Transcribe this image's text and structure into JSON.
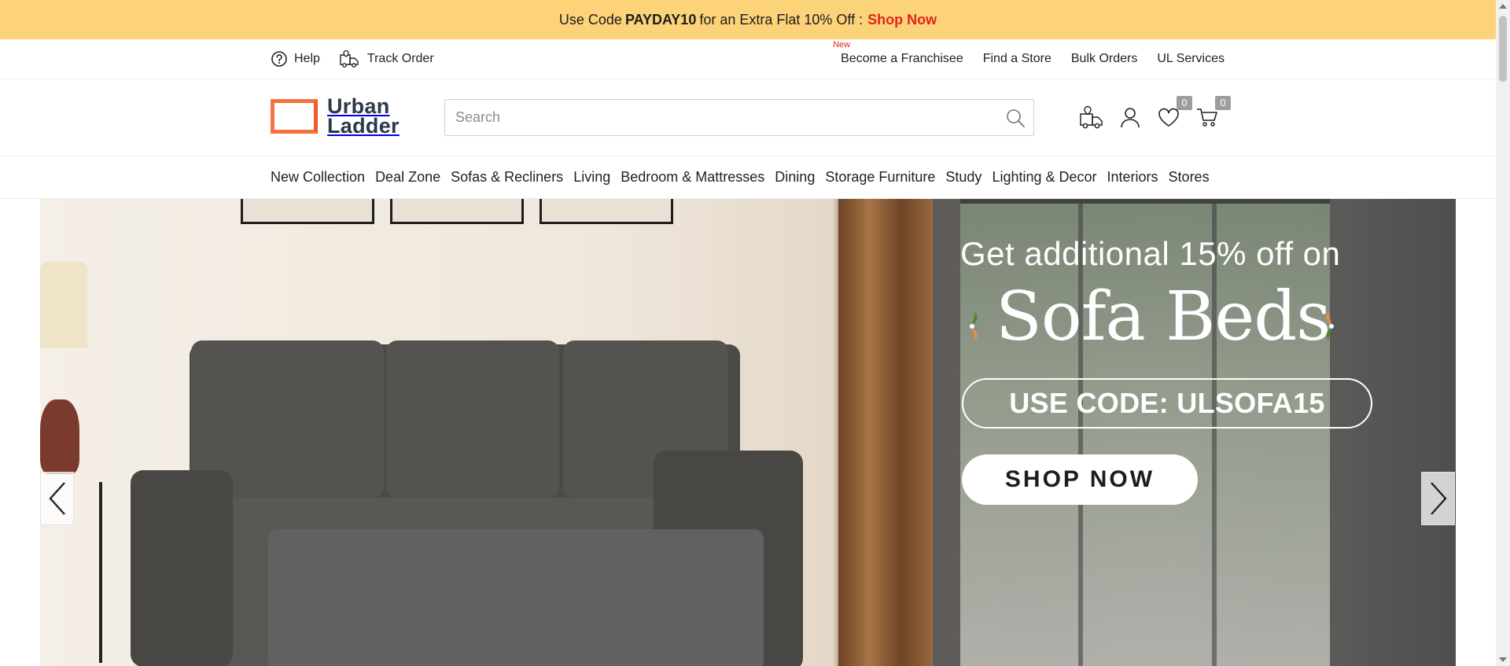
{
  "promo_bar": {
    "prefix": "Use Code",
    "code": "PAYDAY10",
    "suffix": "for an Extra Flat 10% Off :",
    "cta": "Shop Now"
  },
  "utility_bar": {
    "help": "Help",
    "track_order": "Track Order",
    "new_tag": "New",
    "right_links": [
      "Become a Franchisee",
      "Find a Store",
      "Bulk Orders",
      "UL Services"
    ]
  },
  "header": {
    "logo_line1": "Urban",
    "logo_line2": "Ladder",
    "search_placeholder": "Search",
    "wishlist_count": "0",
    "cart_count": "0"
  },
  "nav": {
    "items": [
      "New Collection",
      "Deal Zone",
      "Sofas & Recliners",
      "Living",
      "Bedroom & Mattresses",
      "Dining",
      "Storage Furniture",
      "Study",
      "Lighting & Decor",
      "Interiors",
      "Stores"
    ]
  },
  "hero": {
    "headline": "Get additional 15% off on",
    "product": "Sofa Beds",
    "code_text": "USE CODE: ULSOFA15",
    "cta": "SHOP NOW"
  },
  "colors": {
    "promo_bg": "#fdd37a",
    "accent_red": "#e0261b",
    "logo_orange": "#f37240",
    "logo_text": "#2b3a4a"
  }
}
